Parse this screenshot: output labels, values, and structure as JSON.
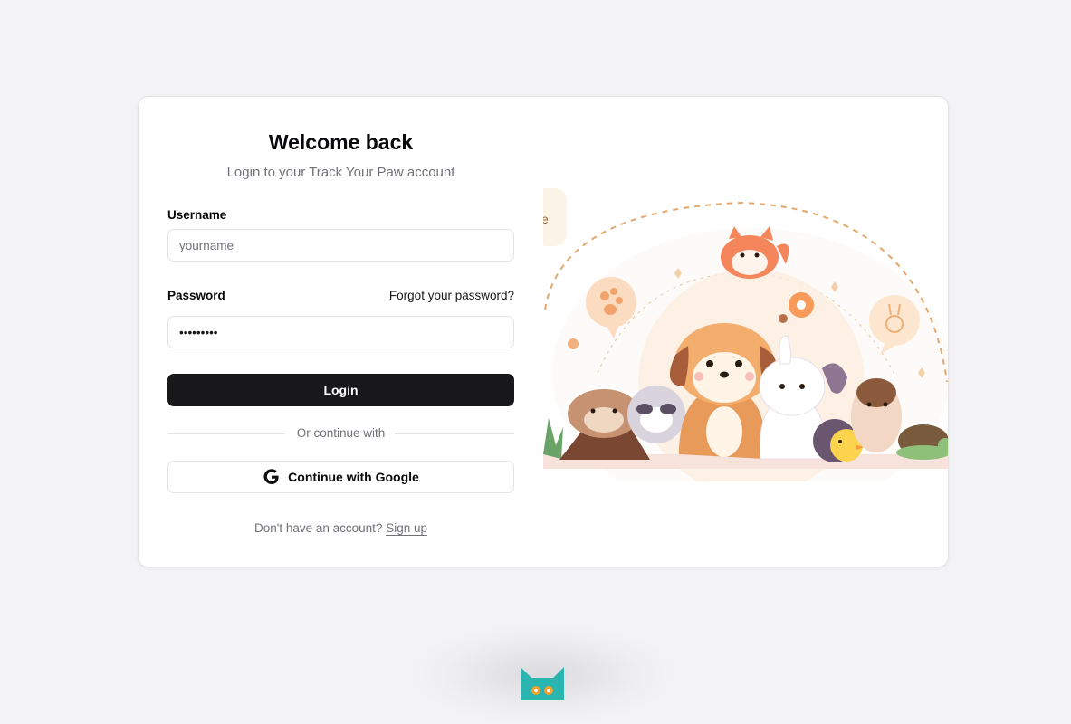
{
  "header": {
    "title": "Welcome back",
    "subtitle": "Login to your Track Your Paw account"
  },
  "form": {
    "username_label": "Username",
    "username_placeholder": "yourname",
    "password_label": "Password",
    "password_value": "password1",
    "forgot_link": "Forgot your password?",
    "login_button": "Login",
    "divider_text": "Or continue with",
    "google_button": "Continue with Google",
    "signup_prompt": "Don't have an account?",
    "signup_link": "Sign up"
  },
  "illustration": {
    "speech_bubble_text": "e"
  },
  "colors": {
    "primary": "#18181b",
    "muted_text": "#71717a",
    "border": "#e4e4e7",
    "background": "#f3f3f5",
    "logo_teal": "#2bb5b0"
  },
  "icons": {
    "google": "google-g-icon",
    "logo": "cat-logo-icon"
  }
}
